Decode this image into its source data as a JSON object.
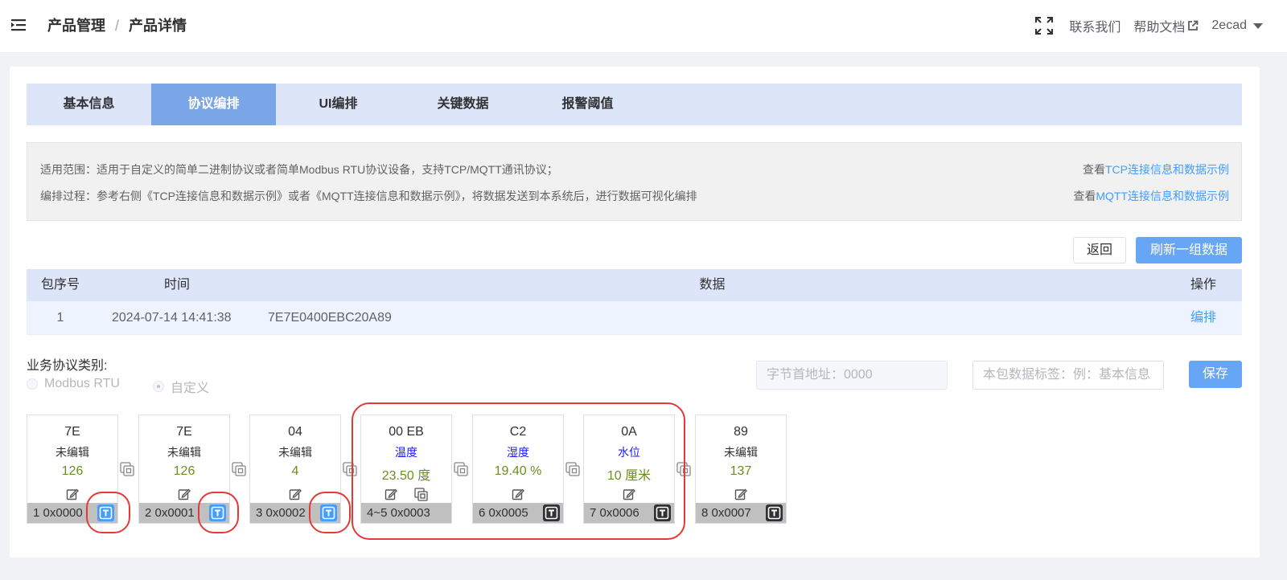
{
  "header": {
    "breadcrumb": [
      "产品管理",
      "产品详情"
    ],
    "contact": "联系我们",
    "help": "帮助文档",
    "user": "2ecad"
  },
  "tabs": [
    {
      "label": "基本信息",
      "active": false
    },
    {
      "label": "协议编排",
      "active": true
    },
    {
      "label": "UI编排",
      "active": false
    },
    {
      "label": "关键数据",
      "active": false
    },
    {
      "label": "报警阈值",
      "active": false
    }
  ],
  "info": {
    "line1": "适用范围：适用于自定义的简单二进制协议或者简单Modbus RTU协议设备，支持TCP/MQTT通讯协议；",
    "line2": "编排过程：参考右侧《TCP连接信息和数据示例》或者《MQTT连接信息和数据示例》，将数据发送到本系统后，进行数据可视化编排",
    "view_prefix": "查看",
    "tcp_link": "TCP连接信息和数据示例",
    "mqtt_link": "MQTT连接信息和数据示例"
  },
  "buttons": {
    "back": "返回",
    "refresh": "刷新一组数据",
    "save": "保存"
  },
  "table": {
    "headers": {
      "seq": "包序号",
      "time": "时间",
      "data": "数据",
      "op": "操作"
    },
    "rows": [
      {
        "seq": "1",
        "time": "2024-07-14 14:41:38",
        "data": "7E7E0400EBC20A89",
        "op": "编排"
      }
    ]
  },
  "protocol": {
    "label": "业务协议类别:",
    "options": [
      "Modbus RTU",
      "自定义"
    ],
    "selected": "自定义",
    "address_placeholder": "字节首地址：0000",
    "tag_placeholder": "本包数据标签：例：基本信息"
  },
  "cards": [
    {
      "hex": "7E",
      "label": "未编辑",
      "value": "126",
      "footer": "1 0x0000",
      "t_active": true
    },
    {
      "hex": "7E",
      "label": "未编辑",
      "value": "126",
      "footer": "2 0x0001",
      "t_active": true
    },
    {
      "hex": "04",
      "label": "未编辑",
      "value": "4",
      "footer": "3 0x0002",
      "t_active": true
    },
    {
      "hex": "00 EB",
      "label": "温度",
      "value": "23.50 度",
      "footer": "4~5 0x0003"
    },
    {
      "hex": "C2",
      "label": "湿度",
      "value": "19.40 %",
      "footer": "6 0x0005",
      "t_active": false
    },
    {
      "hex": "0A",
      "label": "水位",
      "value": "10 厘米",
      "footer": "7 0x0006",
      "t_active": false
    },
    {
      "hex": "89",
      "label": "未编辑",
      "value": "137",
      "footer": "8 0x0007",
      "t_active": false
    }
  ],
  "colors": {
    "accent": "#409eff",
    "tab_active": "#7aa6e8",
    "tab_bar": "#dde5f8",
    "highlight": "#e53935",
    "value_green": "#6b8e23",
    "label_blue": "#1a1aff"
  }
}
